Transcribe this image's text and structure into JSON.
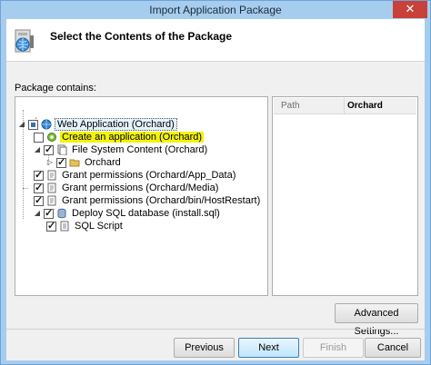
{
  "window": {
    "title": "Import Application Package",
    "close_glyph": "✕"
  },
  "header": {
    "title": "Select the Contents of the Package",
    "icon": "package-globe-icon"
  },
  "tree": {
    "label": "Package contains:",
    "items": [
      {
        "label": "Web Application (Orchard)",
        "checked": "partial",
        "icon": "globe-icon",
        "expander": "◢"
      },
      {
        "label": "Create an application (Orchard)",
        "checked": false,
        "icon": "app-gear-icon",
        "highlighted": true
      },
      {
        "label": "File System Content (Orchard)",
        "checked": true,
        "icon": "files-icon",
        "expander": "◢"
      },
      {
        "label": "Orchard",
        "checked": true,
        "icon": "folder-icon",
        "expander": "▷"
      },
      {
        "label": "Grant permissions (Orchard/App_Data)",
        "checked": true,
        "icon": "permission-icon"
      },
      {
        "label": "Grant permissions (Orchard/Media)",
        "checked": true,
        "icon": "permission-icon"
      },
      {
        "label": "Grant permissions (Orchard/bin/HostRestart)",
        "checked": true,
        "icon": "permission-icon"
      },
      {
        "label": "Deploy SQL database (install.sql)",
        "checked": true,
        "icon": "database-icon",
        "expander": "◢"
      },
      {
        "label": "SQL Script",
        "checked": true,
        "icon": "script-icon"
      }
    ]
  },
  "properties": {
    "key": "Path",
    "value": "Orchard"
  },
  "buttons": {
    "advanced": "Advanced Settings...",
    "previous": "Previous",
    "next": "Next",
    "finish": "Finish",
    "cancel": "Cancel"
  },
  "colors": {
    "highlight": "#f4f40a",
    "titlebar": "#a6cdee",
    "close": "#c8413b"
  }
}
